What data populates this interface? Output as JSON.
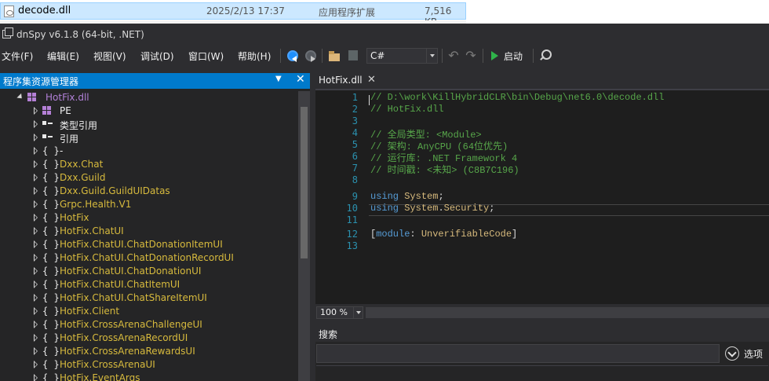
{
  "explorer": {
    "file_name": "decode.dll",
    "modified": "2025/2/13 17:37",
    "type": "应用程序扩展",
    "size": "7,516 KB"
  },
  "window": {
    "title": "dnSpy v6.1.8 (64-bit, .NET)"
  },
  "menu": [
    "文件(F)",
    "编辑(E)",
    "视图(V)",
    "调试(D)",
    "窗口(W)",
    "帮助(H)"
  ],
  "toolbar": {
    "language": "C#",
    "run_label": "启动"
  },
  "assembly_explorer": {
    "title": "程序集资源管理器",
    "root": "HotFix.dll",
    "items": [
      {
        "label": "PE",
        "icon": "assembly-icon",
        "color": "white"
      },
      {
        "label": "类型引用",
        "icon": "reference-icon",
        "color": "white"
      },
      {
        "label": "引用",
        "icon": "reference-icon",
        "color": "white"
      },
      {
        "label": "-",
        "icon": "namespace-icon",
        "color": "white"
      },
      {
        "label": "Dxx.Chat",
        "icon": "namespace-icon",
        "color": "yellow"
      },
      {
        "label": "Dxx.Guild",
        "icon": "namespace-icon",
        "color": "yellow"
      },
      {
        "label": "Dxx.Guild.GuildUIDatas",
        "icon": "namespace-icon",
        "color": "yellow"
      },
      {
        "label": "Grpc.Health.V1",
        "icon": "namespace-icon",
        "color": "yellow"
      },
      {
        "label": "HotFix",
        "icon": "namespace-icon",
        "color": "yellow"
      },
      {
        "label": "HotFix.ChatUI",
        "icon": "namespace-icon",
        "color": "yellow"
      },
      {
        "label": "HotFix.ChatUI.ChatDonationItemUI",
        "icon": "namespace-icon",
        "color": "yellow"
      },
      {
        "label": "HotFix.ChatUI.ChatDonationRecordUI",
        "icon": "namespace-icon",
        "color": "yellow"
      },
      {
        "label": "HotFix.ChatUI.ChatDonationUI",
        "icon": "namespace-icon",
        "color": "yellow"
      },
      {
        "label": "HotFix.ChatUI.ChatItemUI",
        "icon": "namespace-icon",
        "color": "yellow"
      },
      {
        "label": "HotFix.ChatUI.ChatShareItemUI",
        "icon": "namespace-icon",
        "color": "yellow"
      },
      {
        "label": "HotFix.Client",
        "icon": "namespace-icon",
        "color": "yellow"
      },
      {
        "label": "HotFix.CrossArenaChallengeUI",
        "icon": "namespace-icon",
        "color": "yellow"
      },
      {
        "label": "HotFix.CrossArenaRecordUI",
        "icon": "namespace-icon",
        "color": "yellow"
      },
      {
        "label": "HotFix.CrossArenaRewardsUI",
        "icon": "namespace-icon",
        "color": "yellow"
      },
      {
        "label": "HotFix.CrossArenaUI",
        "icon": "namespace-icon",
        "color": "yellow"
      },
      {
        "label": "HotFix.EventArgs",
        "icon": "namespace-icon",
        "color": "yellow"
      }
    ]
  },
  "document": {
    "tab_title": "HotFix.dll",
    "lines": [
      {
        "n": "1",
        "parts": [
          {
            "c": "comment",
            "t": "// D:\\work\\KillHybridCLR\\bin\\Debug\\net6.0\\decode.dll"
          }
        ]
      },
      {
        "n": "2",
        "parts": [
          {
            "c": "comment",
            "t": "// HotFix.dll"
          }
        ]
      },
      {
        "n": "3",
        "parts": []
      },
      {
        "n": "4",
        "parts": [
          {
            "c": "comment",
            "t": "// 全局类型: <Module>"
          }
        ]
      },
      {
        "n": "5",
        "parts": [
          {
            "c": "comment",
            "t": "// 架构: AnyCPU (64位优先)"
          }
        ]
      },
      {
        "n": "6",
        "parts": [
          {
            "c": "comment",
            "t": "// 运行库: .NET Framework 4"
          }
        ]
      },
      {
        "n": "7",
        "parts": [
          {
            "c": "comment",
            "t": "// 时间戳: <未知> (C8B7C196)"
          }
        ]
      },
      {
        "n": "8",
        "parts": []
      },
      {
        "n": "9",
        "parts": [
          {
            "c": "key",
            "t": "using"
          },
          {
            "c": "plain",
            "t": " "
          },
          {
            "c": "ns",
            "t": "System"
          },
          {
            "c": "plain",
            "t": ";"
          }
        ]
      },
      {
        "n": "10",
        "parts": [
          {
            "c": "key",
            "t": "using"
          },
          {
            "c": "plain",
            "t": " "
          },
          {
            "c": "ns",
            "t": "System"
          },
          {
            "c": "plain",
            "t": "."
          },
          {
            "c": "ns",
            "t": "Security"
          },
          {
            "c": "plain",
            "t": ";"
          }
        ]
      },
      {
        "n": "11",
        "parts": []
      },
      {
        "n": "12",
        "parts": [
          {
            "c": "plain",
            "t": "["
          },
          {
            "c": "key",
            "t": "module"
          },
          {
            "c": "plain",
            "t": ": "
          },
          {
            "c": "ns",
            "t": "UnverifiableCode"
          },
          {
            "c": "plain",
            "t": "]"
          }
        ]
      },
      {
        "n": "13",
        "parts": []
      }
    ]
  },
  "zoom": {
    "value": "100 %"
  },
  "search": {
    "title": "搜索",
    "query": "",
    "options_label": "选项"
  }
}
